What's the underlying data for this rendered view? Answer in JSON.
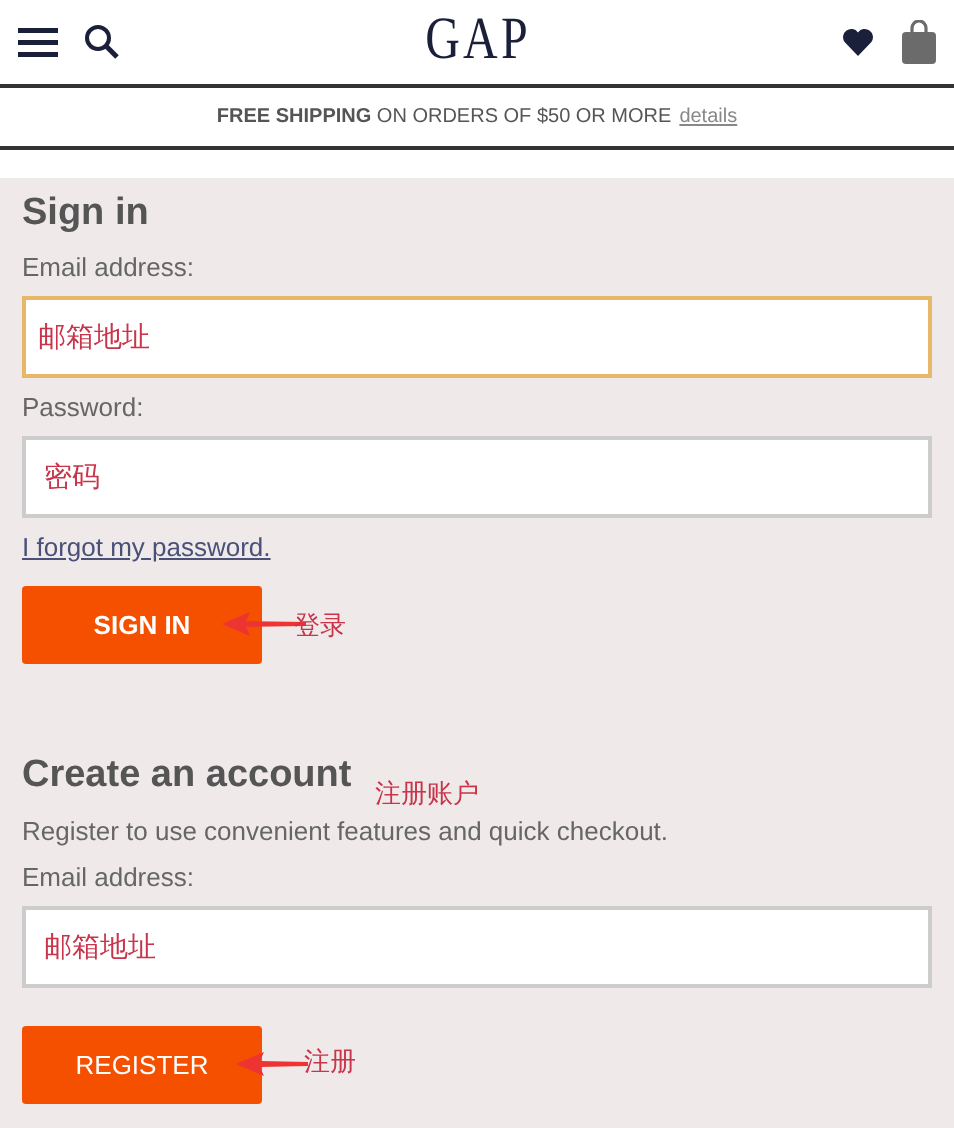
{
  "header": {
    "logo": "GAP"
  },
  "promo": {
    "text": "**FREE SHIPPING** ON ORDERS OF $50 OR MORE",
    "link": "details"
  },
  "sign_in": {
    "title": "Sign in",
    "fields": [
      {
        "label": "Email address:",
        "value": "邮箱地址",
        "focused": true
      },
      {
        "label": "Password:",
        "value": "密码",
        "focused": false
      }
    ],
    "forgot_link": "I forgot my password.",
    "button": "SIGN IN",
    "annotation": "登录"
  },
  "create_account": {
    "title": "Create an account",
    "title_annotation": "注册账户",
    "description": "Register to use convenient features and quick checkout.",
    "fields": [
      {
        "label": "Email address:",
        "value": "邮箱地址",
        "focused": false
      }
    ],
    "button": "REGISTER",
    "annotation": "注册"
  }
}
